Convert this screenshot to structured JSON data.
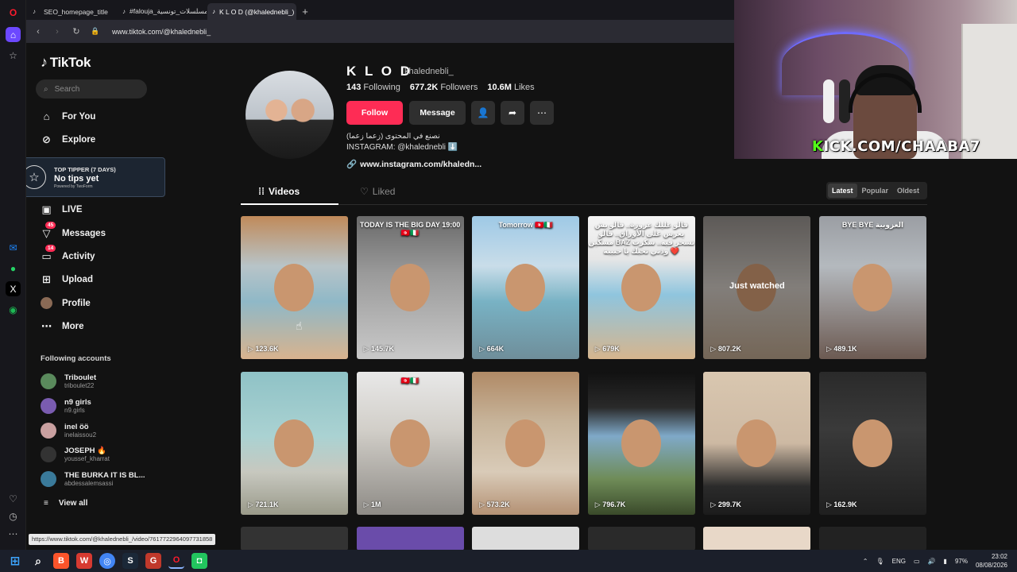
{
  "browser": {
    "tabs": [
      {
        "title": "SEO_homepage_title",
        "active": false
      },
      {
        "title": "#falouja_مسلسلات_تونسية",
        "active": false
      },
      {
        "title": "K L O D (@khalednebli_) |",
        "active": true
      }
    ],
    "new_tab": "+",
    "url": "www.tiktok.com/@khalednebli_",
    "status_url": "https://www.tiktok.com/@khalednebli_/video/7617722964097731858"
  },
  "sidebar": {
    "logo": "TikTok",
    "search_placeholder": "Search",
    "nav": [
      {
        "label": "For You",
        "icon": "home-icon"
      },
      {
        "label": "Explore",
        "icon": "compass-icon"
      },
      {
        "label": "LIVE",
        "icon": "live-icon"
      },
      {
        "label": "Messages",
        "icon": "message-icon",
        "badge": "45"
      },
      {
        "label": "Activity",
        "icon": "inbox-icon",
        "badge": "14"
      },
      {
        "label": "Upload",
        "icon": "upload-icon"
      },
      {
        "label": "Profile",
        "icon": "profile-avatar"
      },
      {
        "label": "More",
        "icon": "more-icon"
      }
    ],
    "tipper": {
      "title": "TOP TIPPER (7 DAYS)",
      "value": "No tips yet",
      "powered": "Powered by TwoForm"
    },
    "following_title": "Following accounts",
    "accounts": [
      {
        "name": "Triboulet",
        "handle": "triboulet22",
        "color": "#5a8a5c"
      },
      {
        "name": "n9 girls",
        "handle": "n9.girls",
        "color": "#7a5cb0"
      },
      {
        "name": "inel öö",
        "handle": "inelaissou2",
        "color": "#c9a0a0"
      },
      {
        "name": "JOSEPH 🔥",
        "handle": "youssef_kharrat",
        "color": "#333"
      },
      {
        "name": "THE BURKA IT IS BL...",
        "handle": "abdessalemsassi",
        "color": "#3a7a9a"
      }
    ],
    "view_all": "View all"
  },
  "profile": {
    "name": "K L O D",
    "handle": "khalednebli_",
    "following_count": "143",
    "following_label": "Following",
    "followers_count": "677.2K",
    "followers_label": "Followers",
    "likes_count": "10.6M",
    "likes_label": "Likes",
    "follow_label": "Follow",
    "message_label": "Message",
    "bio_line1": "نصنع في المحتوى (زعما زعما)",
    "bio_line2": "INSTAGRAM: @khalednebli ⬇️",
    "link": "www.instagram.com/khaledn..."
  },
  "tabs": {
    "videos": "Videos",
    "liked": "Liked"
  },
  "sort": {
    "latest": "Latest",
    "popular": "Popular",
    "oldest": "Oldest"
  },
  "videos": [
    {
      "views": "123.6K",
      "caption": "",
      "bg": "linear-gradient(180deg,#c08a5a 0%,#b8c4c8 35%,#8fb8c7 60%,#d8b38e 100%)"
    },
    {
      "views": "145.7K",
      "caption": "TODAY IS THE BIG DAY 19:00 🇹🇳🇮🇹",
      "bg": "linear-gradient(180deg,#6a6a6a 0%,#9a9a9a 40%,#c9c9c9 100%)"
    },
    {
      "views": "664K",
      "caption": "Tomorrow 🇹🇳🇮🇹",
      "bg": "linear-gradient(180deg,#9ec9e6 0%,#c9dde9 35%,#78b2c4 60%,#6f8e9a 100%)"
    },
    {
      "views": "679K",
      "caption": "قالو عليك عزوزة.. قالو بش يعرس على الأوراق.. قالو مسكين BAZ تسحر فيه.. سكرت وذني تحبك يا حبيبة ❤️",
      "bg": "linear-gradient(180deg,#f4f4f4 0%,#e6e6e6 30%,#8fc5de 55%,#d6b58e 100%)"
    },
    {
      "views": "807.2K",
      "caption": "",
      "watched": "Just watched",
      "bg": "linear-gradient(180deg,#8f8a86 0%,#c8c2bc 50%,#b39d86 100%)"
    },
    {
      "views": "489.1K",
      "caption": "BYE BYE العزوبية",
      "bg": "linear-gradient(180deg,#9b9ea3 0%,#b4b9be 35%,#6c5a52 100%)"
    },
    {
      "views": "721.1K",
      "caption": "",
      "bg": "linear-gradient(180deg,#8fc2c6 0%,#aad2d2 45%,#c7c8bf 70%,#9a9a8a 100%)"
    },
    {
      "views": "1M",
      "caption": "🇹🇳🇮🇹",
      "bg": "linear-gradient(180deg,#e8e8e8 0%,#d2cfc9 40%,#8e8b86 100%)"
    },
    {
      "views": "573.2K",
      "caption": "",
      "bg": "linear-gradient(180deg,#b08a66 0%,#c7b49a 35%,#d9cbb8 70%,#b49174 100%)"
    },
    {
      "views": "796.7K",
      "caption": "",
      "bg": "linear-gradient(180deg,#111 0%,#2a2a2a 25%,#7fa9c8 45%,#6f8c58 75%,#3a4a2a 100%)"
    },
    {
      "views": "299.7K",
      "caption": "",
      "bg": "linear-gradient(180deg,#d9c7b0 0%,#cdb9a3 50%,#2b2b2b 80%,#1c1c1c 100%)"
    },
    {
      "views": "162.9K",
      "caption": "",
      "bg": "linear-gradient(180deg,#2a2a2a 0%,#3a3a3a 40%,#1f1f1f 100%)"
    }
  ],
  "webcam": {
    "kick_prefix": "K",
    "kick_rest": "ICK.COM/CHAABA7"
  },
  "taskbar": {
    "lang": "ENG",
    "battery": "97%",
    "time": "23:02",
    "date": "08/08/2026"
  }
}
